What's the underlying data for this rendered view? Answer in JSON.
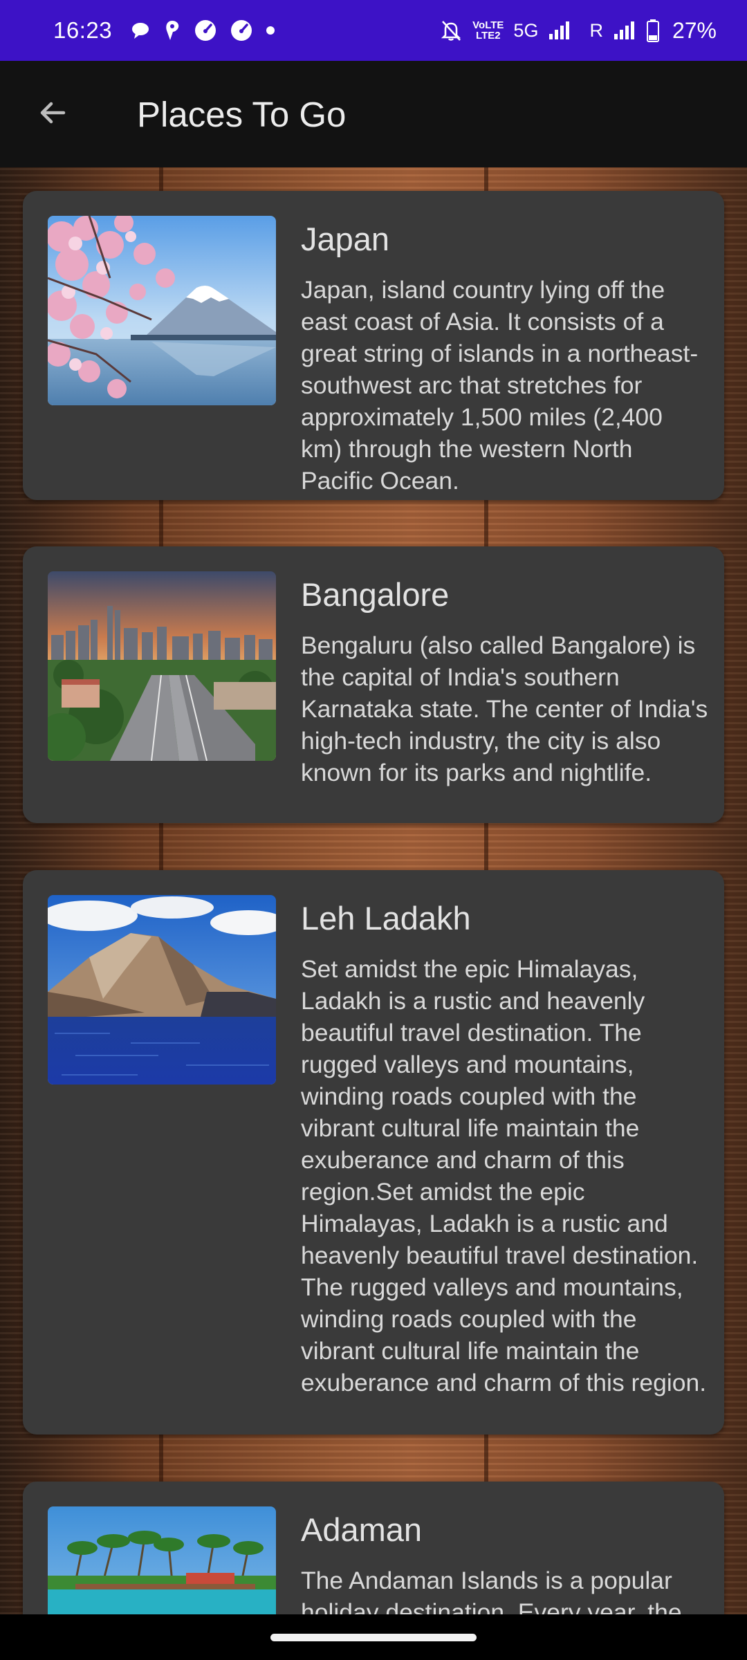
{
  "status_bar": {
    "time": "16:23",
    "network_label_top": "VoLTE",
    "network_label_bottom": "LTE2",
    "network_type": "5G",
    "roaming": "R",
    "battery_percent": "27%"
  },
  "app_bar": {
    "title": "Places To Go"
  },
  "places": [
    {
      "title": "Japan",
      "description": "Japan, island country lying off the east coast of Asia. It consists of a great string of islands in a northeast-southwest arc that stretches for approximately 1,500 miles (2,400 km) through the western North Pacific Ocean."
    },
    {
      "title": "Bangalore",
      "description": "Bengaluru (also called Bangalore) is the capital of India's southern Karnataka state. The center of India's high-tech industry, the city is also known for its parks and nightlife."
    },
    {
      "title": "Leh Ladakh",
      "description": "Set amidst the epic Himalayas, Ladakh is a rustic and heavenly beautiful travel destination. The rugged valleys and mountains, winding roads coupled with the vibrant cultural life maintain the exuberance and charm of this region.Set amidst the epic Himalayas, Ladakh is a rustic and heavenly beautiful travel destination. The rugged valleys and mountains, winding roads coupled with the vibrant cultural life maintain the exuberance and charm of this region."
    },
    {
      "title": "Adaman",
      "description": "The Andaman Islands is a popular holiday destination. Every year, the"
    }
  ],
  "colors": {
    "status_bar": "#3d12c6",
    "app_bar": "#121212",
    "card": "#3a3a3a",
    "text": "#e3e3e3"
  }
}
